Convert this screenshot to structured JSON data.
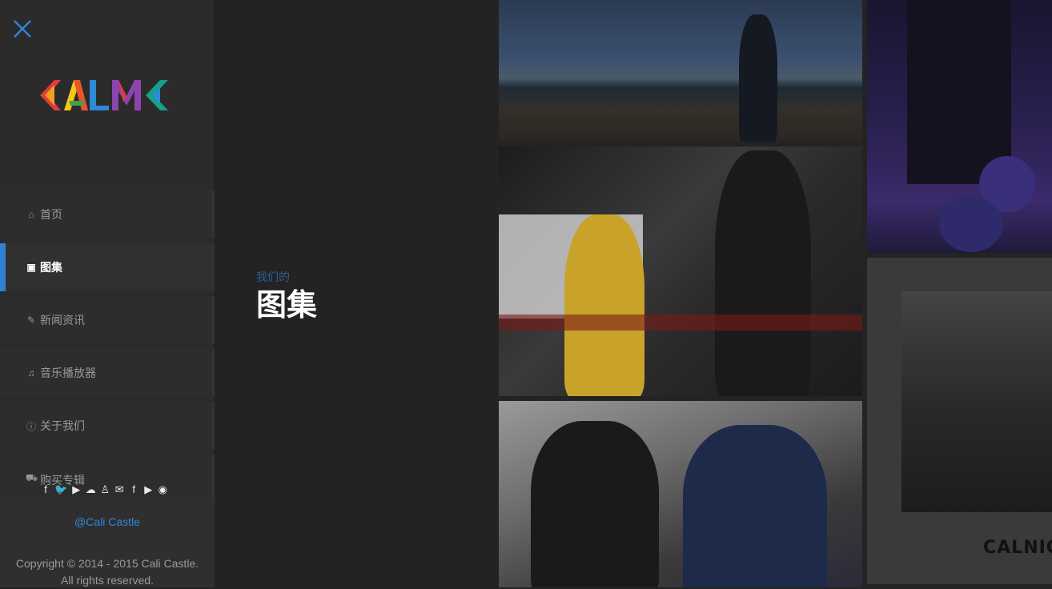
{
  "sidebar": {
    "close_icon": "close-x-icon",
    "logo_text": "CALNIC",
    "nav": [
      {
        "label": "首页",
        "icon": "home-icon",
        "active": false
      },
      {
        "label": "图集",
        "icon": "image-icon",
        "active": true
      },
      {
        "label": "新闻资讯",
        "icon": "pencil-icon",
        "active": false
      },
      {
        "label": "音乐播放器",
        "icon": "music-note-icon",
        "active": false
      },
      {
        "label": "关于我们",
        "icon": "info-icon",
        "active": false
      },
      {
        "label": "购买专辑",
        "icon": "cart-icon",
        "active": false
      }
    ],
    "social_icons": [
      "facebook-icon",
      "twitter-icon",
      "youtube-icon",
      "soundcloud-icon",
      "qq-icon",
      "wechat-icon",
      "facebook-icon",
      "youtube-icon",
      "weibo-icon"
    ],
    "handle": "@Cali Castle",
    "copyright_line1": "Copyright © 2014 - 2015 Cali Castle.",
    "copyright_line2": "All rights reserved."
  },
  "main": {
    "subtitle": "我们的",
    "title": "图集"
  },
  "gallery": {
    "caption_5": "CALNIC × S"
  },
  "colors": {
    "accent": "#2f7fd3",
    "sidebar_bg": "#2b2b2b",
    "page_bg": "#232323"
  }
}
